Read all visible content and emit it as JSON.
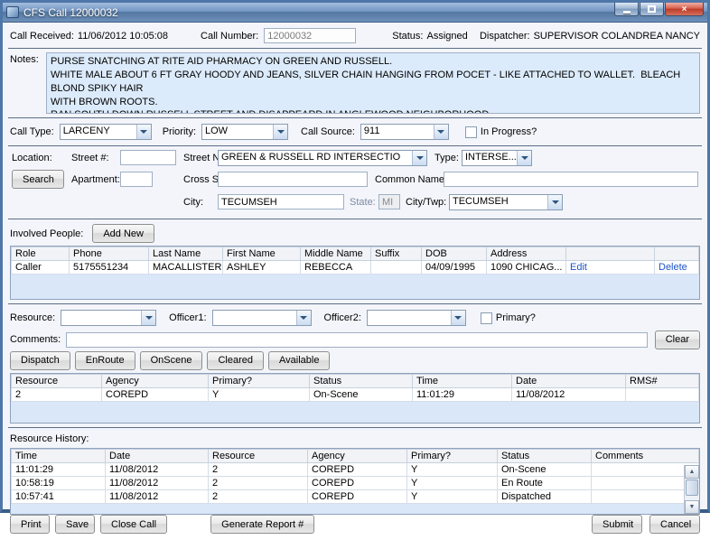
{
  "window": {
    "title": "CFS Call 12000032",
    "close_glyph": "×"
  },
  "header": {
    "call_received_label": "Call Received:",
    "call_received_value": "11/06/2012 10:05:08",
    "call_number_label": "Call Number:",
    "call_number_value": "12000032",
    "status_label": "Status:",
    "status_value": "Assigned",
    "dispatcher_label": "Dispatcher:",
    "dispatcher_value": "SUPERVISOR COLANDREA NANCY"
  },
  "notes": {
    "label": "Notes:",
    "value": "PURSE SNATCHING AT RITE AID PHARMACY ON GREEN AND RUSSELL.\nWHITE MALE ABOUT 6 FT GRAY HOODY AND JEANS, SILVER CHAIN HANGING FROM POCET - LIKE ATTACHED TO WALLET.  BLEACH BLOND SPIKY HAIR\nWITH BROWN ROOTS.\nRAN SOUTH DOWN RUSSELL STREET AND DISAPPEARD IN ANGLEWOOD NEIGHBORHOOD."
  },
  "call_info": {
    "call_type_label": "Call Type:",
    "call_type_value": "LARCENY",
    "priority_label": "Priority:",
    "priority_value": "LOW",
    "call_source_label": "Call Source:",
    "call_source_value": "911",
    "in_progress_label": "In Progress?"
  },
  "location": {
    "label": "Location:",
    "street_number_label": "Street #:",
    "street_number_value": "",
    "street_name_label": "Street Name:",
    "street_name_value": "GREEN & RUSSELL RD INTERSECTIO",
    "type_label": "Type:",
    "type_value": "INTERSE...",
    "search_button": "Search",
    "apartment_label": "Apartment:",
    "apartment_value": "",
    "cross_street_label": "Cross Street:",
    "cross_street_value": "",
    "common_name_label": "Common Name:",
    "common_name_value": "",
    "city_label": "City:",
    "city_value": "TECUMSEH",
    "state_label": "State:",
    "state_value": "MI",
    "citytwp_label": "City/Twp:",
    "citytwp_value": "TECUMSEH"
  },
  "involved_people": {
    "label": "Involved People:",
    "add_new_button": "Add New",
    "columns": [
      "Role",
      "Phone",
      "Last Name",
      "First Name",
      "Middle Name",
      "Suffix",
      "DOB",
      "Address",
      "",
      ""
    ],
    "rows": [
      {
        "role": "Caller",
        "phone": "5175551234",
        "last_name": "MACALLISTER",
        "first_name": "ASHLEY",
        "middle_name": "REBECCA",
        "suffix": "",
        "dob": "04/09/1995",
        "address": "1090 CHICAG...",
        "edit_link": "Edit",
        "delete_link": "Delete"
      }
    ]
  },
  "resource_panel": {
    "resource_label": "Resource:",
    "resource_value": "",
    "officer1_label": "Officer1:",
    "officer1_value": "",
    "officer2_label": "Officer2:",
    "officer2_value": "",
    "primary_label": "Primary?",
    "comments_label": "Comments:",
    "comments_value": "",
    "clear_button": "Clear",
    "action_buttons": [
      "Dispatch",
      "EnRoute",
      "OnScene",
      "Cleared",
      "Available"
    ],
    "columns": [
      "Resource",
      "Agency",
      "Primary?",
      "Status",
      "Time",
      "Date",
      "RMS#"
    ],
    "rows": [
      {
        "resource": "2",
        "agency": "COREPD",
        "primary": "Y",
        "status": "On-Scene",
        "time": "11:01:29",
        "date": "11/08/2012",
        "rms": ""
      }
    ]
  },
  "resource_history": {
    "label": "Resource History:",
    "columns": [
      "Time",
      "Date",
      "Resource",
      "Agency",
      "Primary?",
      "Status",
      "Comments"
    ],
    "rows": [
      {
        "time": "11:01:29",
        "date": "11/08/2012",
        "resource": "2",
        "agency": "COREPD",
        "primary": "Y",
        "status": "On-Scene",
        "comments": ""
      },
      {
        "time": "10:58:19",
        "date": "11/08/2012",
        "resource": "2",
        "agency": "COREPD",
        "primary": "Y",
        "status": "En Route",
        "comments": ""
      },
      {
        "time": "10:57:41",
        "date": "11/08/2012",
        "resource": "2",
        "agency": "COREPD",
        "primary": "Y",
        "status": "Dispatched",
        "comments": ""
      }
    ],
    "scroll_up_glyph": "▲",
    "scroll_down_glyph": "▼"
  },
  "footer": {
    "print_button": "Print",
    "save_button": "Save",
    "close_call_button": "Close Call",
    "generate_report_button": "Generate Report #",
    "submit_button": "Submit",
    "cancel_button": "Cancel"
  }
}
